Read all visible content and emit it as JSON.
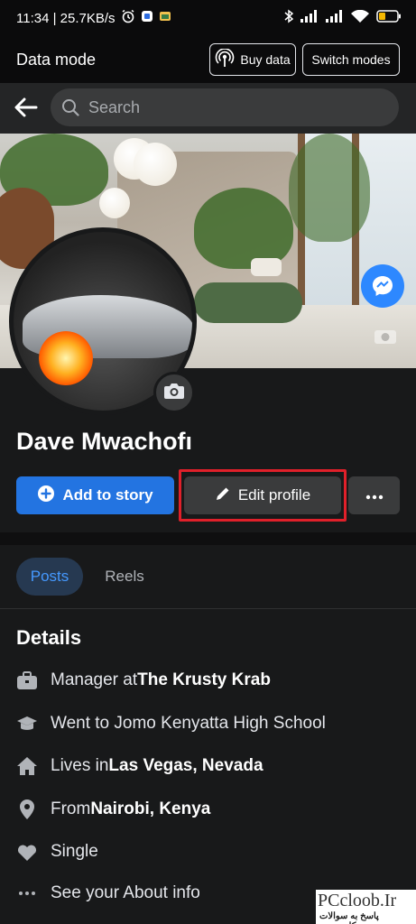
{
  "status_bar": {
    "time_speed": "11:34 | 25.7KB/s"
  },
  "data_mode": {
    "title": "Data mode",
    "buy_label": "Buy data",
    "switch_label": "Switch modes"
  },
  "search": {
    "placeholder": "Search"
  },
  "profile": {
    "name": "Dave Mwachofı"
  },
  "actions": {
    "add_story": "Add to story",
    "edit_profile": "Edit profile"
  },
  "tabs": [
    {
      "label": "Posts",
      "active": true
    },
    {
      "label": "Reels",
      "active": false
    }
  ],
  "details": {
    "title": "Details",
    "items": [
      {
        "icon": "briefcase-icon",
        "prefix": "Manager at ",
        "bold": "The Krusty Krab"
      },
      {
        "icon": "graduation-cap-icon",
        "prefix": "Went to Jomo Kenyatta High School",
        "bold": ""
      },
      {
        "icon": "home-icon",
        "prefix": "Lives in ",
        "bold": "Las Vegas, Nevada"
      },
      {
        "icon": "location-pin-icon",
        "prefix": "From ",
        "bold": "Nairobi, Kenya"
      },
      {
        "icon": "heart-icon",
        "prefix": "Single",
        "bold": ""
      },
      {
        "icon": "more-dots-icon",
        "prefix": "See your About info",
        "bold": ""
      }
    ]
  },
  "watermark": {
    "line1": "PCcloob.Ir",
    "line2": "پاسخ به سوالات کامپیوتری"
  },
  "colors": {
    "accent": "#2374e1",
    "highlight": "#e0202a",
    "background": "#18191a"
  }
}
